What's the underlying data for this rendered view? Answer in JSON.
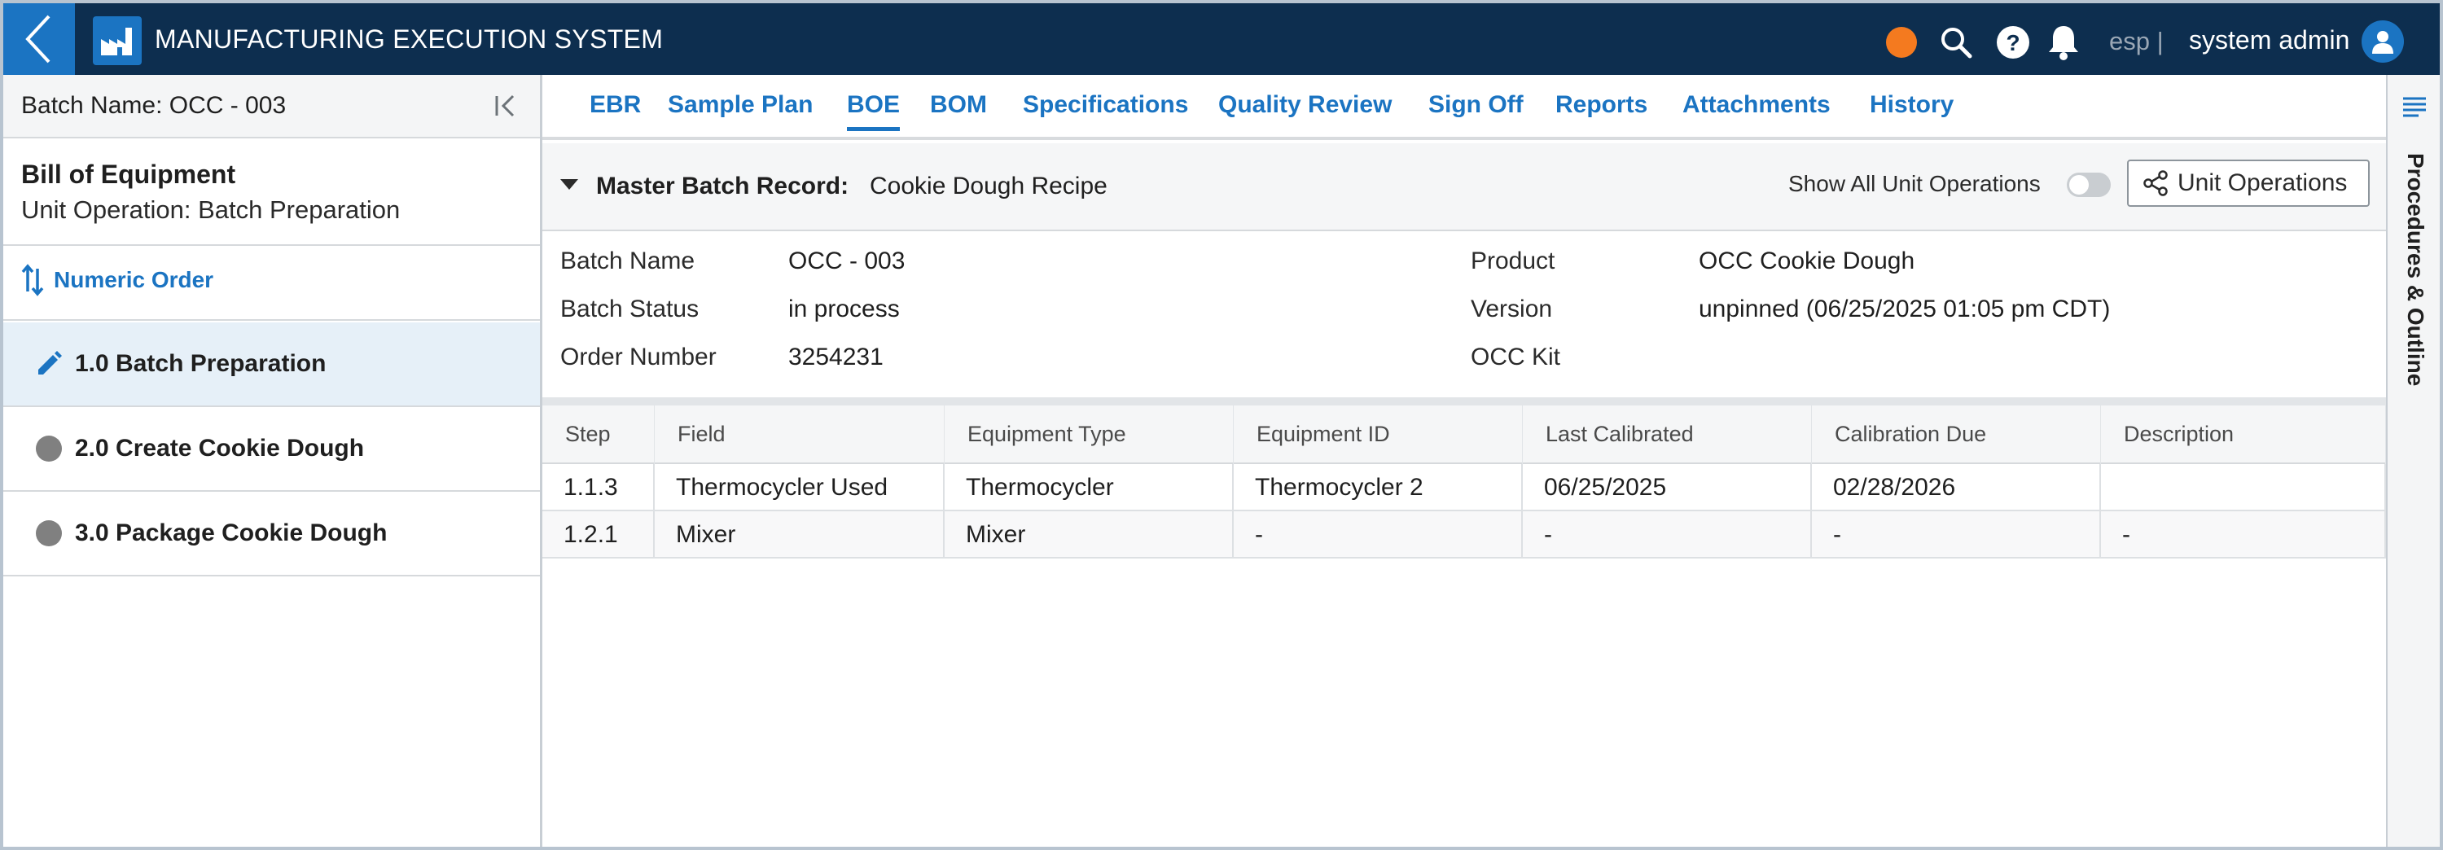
{
  "header": {
    "title": "MANUFACTURING EXECUTION SYSTEM",
    "language": "esp |",
    "user": "system admin",
    "status_color": "#f47a1f",
    "icons": [
      "back-chevron-icon",
      "factory-icon",
      "search-icon",
      "help-icon",
      "bell-icon",
      "user-icon"
    ]
  },
  "sidebar": {
    "batch_name": "Batch Name: OCC - 003",
    "title": "Bill of Equipment",
    "subtitle": "Unit Operation: Batch Preparation",
    "sort_label": "Numeric Order",
    "items": [
      {
        "label": "1.0 Batch Preparation",
        "icon": "pencil-icon",
        "active": true
      },
      {
        "label": "2.0 Create Cookie Dough",
        "icon": "status-dot-icon",
        "active": false
      },
      {
        "label": "3.0 Package Cookie Dough",
        "icon": "status-dot-icon",
        "active": false
      }
    ]
  },
  "tabs": [
    {
      "label": "EBR"
    },
    {
      "label": "Sample Plan"
    },
    {
      "label": "BOE",
      "active": true
    },
    {
      "label": "BOM"
    },
    {
      "label": "Specifications"
    },
    {
      "label": "Quality Review"
    },
    {
      "label": "Sign Off"
    },
    {
      "label": "Reports"
    },
    {
      "label": "Attachments"
    },
    {
      "label": "History"
    }
  ],
  "master_batch": {
    "label": "Master Batch Record:",
    "value": "Cookie Dough Recipe",
    "show_all_label": "Show All Unit Operations",
    "show_all_on": false,
    "unit_ops_button": "Unit Operations"
  },
  "info": {
    "batch_name_label": "Batch Name",
    "batch_name": "OCC - 003",
    "batch_status_label": "Batch Status",
    "batch_status": "in process",
    "order_number_label": "Order Number",
    "order_number": "3254231",
    "product_label": "Product",
    "product": "OCC Cookie Dough",
    "version_label": "Version",
    "version": "unpinned (06/25/2025 01:05 pm CDT)",
    "kit_label": "OCC Kit"
  },
  "table": {
    "columns": [
      "Step",
      "Field",
      "Equipment Type",
      "Equipment ID",
      "Last Calibrated",
      "Calibration Due",
      "Description"
    ],
    "rows": [
      [
        "1.1.3",
        "Thermocycler Used",
        "Thermocycler",
        "Thermocycler 2",
        "06/25/2025",
        "02/28/2026",
        ""
      ],
      [
        "1.2.1",
        "Mixer",
        "Mixer",
        "-",
        "-",
        "-",
        "-"
      ]
    ]
  },
  "rail": {
    "label": "Procedures & Outline",
    "icon": "list-icon"
  },
  "colors": {
    "header_bg": "#0d2e4f",
    "accent": "#1b74c2",
    "active_row": "#e6f0f8"
  }
}
